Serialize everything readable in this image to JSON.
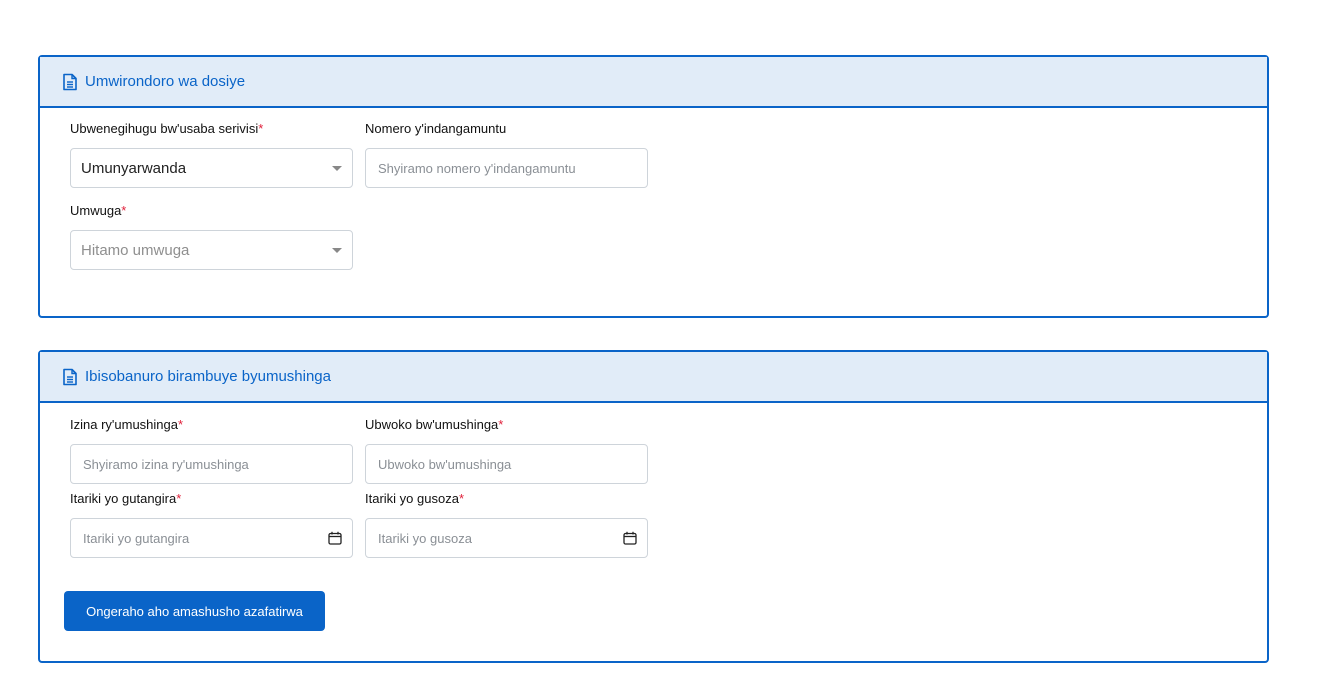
{
  "section1": {
    "title": "Umwirondoro wa dosiye",
    "icon": "document-icon",
    "nationality": {
      "label": "Ubwenegihugu bw'usaba serivisi",
      "required": "*",
      "value": "Umunyarwanda"
    },
    "id_number": {
      "label": "Nomero y'indangamuntu",
      "placeholder": "Shyiramo nomero y'indangamuntu"
    },
    "profession": {
      "label": "Umwuga",
      "required": "*",
      "placeholder": "Hitamo umwuga"
    }
  },
  "section2": {
    "title": "Ibisobanuro birambuye byumushinga",
    "icon": "document-icon",
    "project_name": {
      "label": "Izina ry'umushinga",
      "required": "*",
      "placeholder": "Shyiramo izina ry'umushinga"
    },
    "project_type": {
      "label": "Ubwoko bw'umushinga",
      "required": "*",
      "placeholder": "Ubwoko bw'umushinga"
    },
    "start_date": {
      "label": "Itariki yo gutangira",
      "required": "*",
      "placeholder": "Itariki yo gutangira"
    },
    "end_date": {
      "label": "Itariki yo gusoza",
      "required": "*",
      "placeholder": "Itariki yo gusoza"
    },
    "add_button": "Ongeraho aho amashusho azafatirwa"
  },
  "colors": {
    "accent": "#0a64c8",
    "header_bg": "#e1ecf8",
    "required": "#e0203a"
  }
}
